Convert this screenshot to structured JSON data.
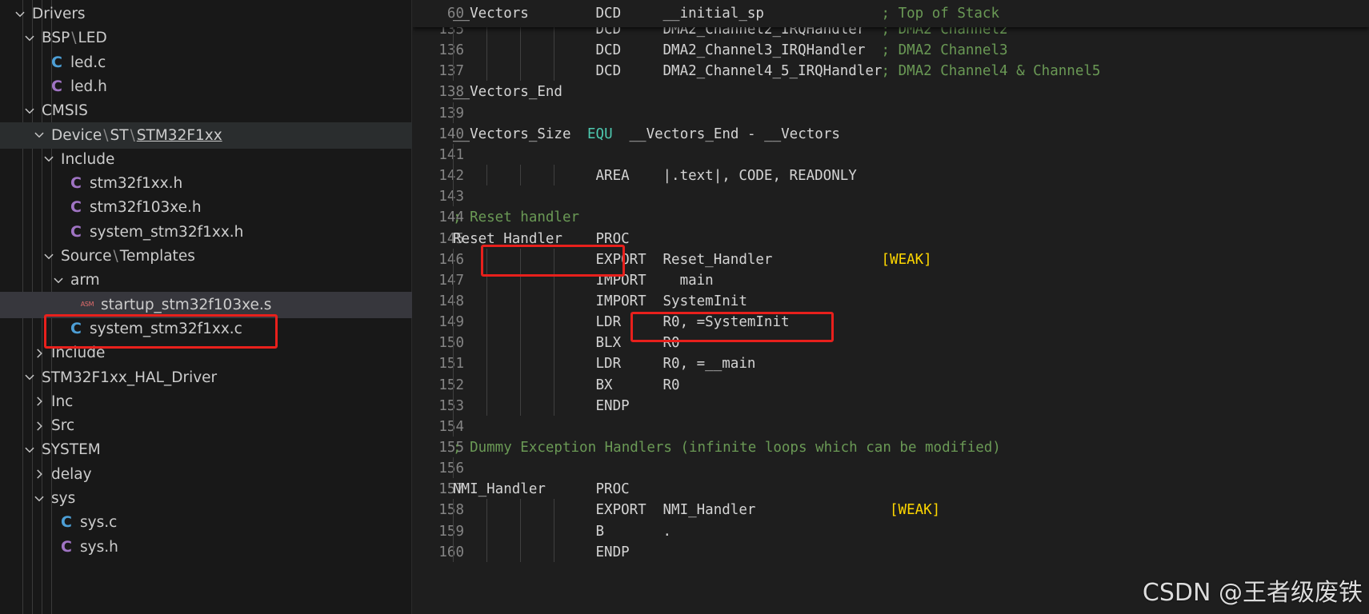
{
  "explorer": {
    "rows": [
      {
        "level": 0,
        "type": "folder",
        "expanded": true,
        "segments": [
          "Drivers"
        ]
      },
      {
        "level": 1,
        "type": "folder",
        "expanded": true,
        "segments": [
          "BSP",
          "LED"
        ]
      },
      {
        "level": 2,
        "type": "file",
        "icon": "c-file-icon",
        "color": "#4d9fd6",
        "segments": [
          "led.c"
        ]
      },
      {
        "level": 2,
        "type": "file",
        "icon": "c-header-icon",
        "color": "#a074c4",
        "segments": [
          "led.h"
        ]
      },
      {
        "level": 1,
        "type": "folder",
        "expanded": true,
        "segments": [
          "CMSIS"
        ]
      },
      {
        "level": 2,
        "type": "folder",
        "expanded": true,
        "segments": [
          "Device",
          "ST",
          "STM32F1xx"
        ],
        "underline_last": true,
        "state": "hover"
      },
      {
        "level": 3,
        "type": "folder",
        "expanded": true,
        "segments": [
          "Include"
        ]
      },
      {
        "level": 4,
        "type": "file",
        "icon": "c-header-icon",
        "color": "#a074c4",
        "segments": [
          "stm32f1xx.h"
        ]
      },
      {
        "level": 4,
        "type": "file",
        "icon": "c-header-icon",
        "color": "#a074c4",
        "segments": [
          "stm32f103xe.h"
        ]
      },
      {
        "level": 4,
        "type": "file",
        "icon": "c-header-icon",
        "color": "#a074c4",
        "segments": [
          "system_stm32f1xx.h"
        ]
      },
      {
        "level": 3,
        "type": "folder",
        "expanded": true,
        "segments": [
          "Source",
          "Templates"
        ]
      },
      {
        "level": 4,
        "type": "folder",
        "expanded": true,
        "segments": [
          "arm"
        ]
      },
      {
        "level": 5,
        "type": "file",
        "icon": "asm-file-icon",
        "icon_text": "ASM",
        "segments": [
          "startup_stm32f103xe.s"
        ],
        "state": "active"
      },
      {
        "level": 4,
        "type": "file",
        "icon": "c-file-icon",
        "color": "#4d9fd6",
        "segments": [
          "system_stm32f1xx.c"
        ]
      },
      {
        "level": 2,
        "type": "folder",
        "expanded": false,
        "segments": [
          "Include"
        ]
      },
      {
        "level": 1,
        "type": "folder",
        "expanded": true,
        "segments": [
          "STM32F1xx_HAL_Driver"
        ]
      },
      {
        "level": 2,
        "type": "folder",
        "expanded": false,
        "segments": [
          "Inc"
        ]
      },
      {
        "level": 2,
        "type": "folder",
        "expanded": false,
        "segments": [
          "Src"
        ]
      },
      {
        "level": 1,
        "type": "folder",
        "expanded": true,
        "segments": [
          "SYSTEM"
        ]
      },
      {
        "level": 2,
        "type": "folder",
        "expanded": false,
        "segments": [
          "delay"
        ]
      },
      {
        "level": 2,
        "type": "folder",
        "expanded": true,
        "segments": [
          "sys"
        ]
      },
      {
        "level": 3,
        "type": "file",
        "icon": "c-file-icon",
        "color": "#4d9fd6",
        "segments": [
          "sys.c"
        ]
      },
      {
        "level": 3,
        "type": "file",
        "icon": "c-header-icon",
        "color": "#a074c4",
        "segments": [
          "sys.h"
        ]
      }
    ]
  },
  "editor": {
    "sticky_line": {
      "num": "60",
      "tokens": [
        {
          "col": 0,
          "text": "__Vectors"
        },
        {
          "col": 17,
          "text": "DCD"
        },
        {
          "col": 25,
          "text": "__initial_sp"
        },
        {
          "col": 51,
          "text": "; Top of Stack",
          "cls": "cm"
        }
      ]
    },
    "lines": [
      {
        "num": "135",
        "partial": true,
        "guides": 4,
        "tokens": [
          {
            "col": 17,
            "text": "DCD"
          },
          {
            "col": 25,
            "text": "DMA2_Channel2_IRQHandler"
          },
          {
            "col": 51,
            "text": "; DMA2 Channel2",
            "cls": "cm"
          }
        ]
      },
      {
        "num": "136",
        "guides": 4,
        "tokens": [
          {
            "col": 17,
            "text": "DCD"
          },
          {
            "col": 25,
            "text": "DMA2_Channel3_IRQHandler"
          },
          {
            "col": 51,
            "text": "; DMA2 Channel3",
            "cls": "cm"
          }
        ]
      },
      {
        "num": "137",
        "guides": 4,
        "tokens": [
          {
            "col": 17,
            "text": "DCD"
          },
          {
            "col": 25,
            "text": "DMA2_Channel4_5_IRQHandler"
          },
          {
            "col": 51,
            "text": "; DMA2 Channel4 & Channel5",
            "cls": "cm"
          }
        ]
      },
      {
        "num": "138",
        "guides": 0,
        "tokens": [
          {
            "col": 0,
            "text": "__Vectors_End"
          }
        ]
      },
      {
        "num": "139",
        "guides": 1,
        "tokens": []
      },
      {
        "num": "140",
        "guides": 0,
        "tokens": [
          {
            "col": 0,
            "text": "__Vectors_Size"
          },
          {
            "col": 16,
            "text": "EQU",
            "cls": "kw"
          },
          {
            "col": 21,
            "text": "__Vectors_End - __Vectors"
          }
        ]
      },
      {
        "num": "141",
        "guides": 1,
        "tokens": []
      },
      {
        "num": "142",
        "guides": 4,
        "tokens": [
          {
            "col": 17,
            "text": "AREA"
          },
          {
            "col": 25,
            "text": "|.text|, CODE, READONLY"
          }
        ]
      },
      {
        "num": "143",
        "guides": 1,
        "tokens": []
      },
      {
        "num": "144",
        "guides": 0,
        "tokens": [
          {
            "col": 0,
            "text": "; Reset handler",
            "cls": "cm"
          }
        ]
      },
      {
        "num": "145",
        "guides": 0,
        "tokens": [
          {
            "col": 0,
            "text": "Reset_Handler"
          },
          {
            "col": 17,
            "text": "PROC"
          }
        ]
      },
      {
        "num": "146",
        "guides": 4,
        "tokens": [
          {
            "col": 17,
            "text": "EXPORT"
          },
          {
            "col": 25,
            "text": "Reset_Handler"
          },
          {
            "col": 51,
            "text": "[WEAK]",
            "cls": "br"
          }
        ]
      },
      {
        "num": "147",
        "guides": 4,
        "tokens": [
          {
            "col": 17,
            "text": "IMPORT"
          },
          {
            "col": 25,
            "text": "  main"
          }
        ]
      },
      {
        "num": "148",
        "guides": 4,
        "tokens": [
          {
            "col": 17,
            "text": "IMPORT"
          },
          {
            "col": 25,
            "text": "SystemInit"
          }
        ]
      },
      {
        "num": "149",
        "guides": 4,
        "tokens": [
          {
            "col": 17,
            "text": "LDR"
          },
          {
            "col": 25,
            "text": "R0, =SystemInit"
          }
        ]
      },
      {
        "num": "150",
        "guides": 4,
        "tokens": [
          {
            "col": 17,
            "text": "BLX"
          },
          {
            "col": 25,
            "text": "R0"
          }
        ]
      },
      {
        "num": "151",
        "guides": 4,
        "tokens": [
          {
            "col": 17,
            "text": "LDR"
          },
          {
            "col": 25,
            "text": "R0, =__main"
          }
        ]
      },
      {
        "num": "152",
        "guides": 4,
        "tokens": [
          {
            "col": 17,
            "text": "BX"
          },
          {
            "col": 25,
            "text": "R0"
          }
        ]
      },
      {
        "num": "153",
        "guides": 4,
        "tokens": [
          {
            "col": 17,
            "text": "ENDP"
          }
        ]
      },
      {
        "num": "154",
        "guides": 1,
        "tokens": []
      },
      {
        "num": "155",
        "guides": 0,
        "tokens": [
          {
            "col": 0,
            "text": "; Dummy Exception Handlers (infinite loops which can be modified)",
            "cls": "cm"
          }
        ]
      },
      {
        "num": "156",
        "guides": 1,
        "tokens": []
      },
      {
        "num": "157",
        "guides": 0,
        "tokens": [
          {
            "col": 0,
            "text": "NMI_Handler"
          },
          {
            "col": 17,
            "text": "PROC"
          }
        ]
      },
      {
        "num": "158",
        "guides": 4,
        "tokens": [
          {
            "col": 17,
            "text": "EXPORT"
          },
          {
            "col": 25,
            "text": "NMI_Handler"
          },
          {
            "col": 52,
            "text": "[WEAK]",
            "cls": "br"
          }
        ]
      },
      {
        "num": "159",
        "guides": 4,
        "tokens": [
          {
            "col": 17,
            "text": "B"
          },
          {
            "col": 25,
            "text": "."
          }
        ]
      },
      {
        "num": "160",
        "guides": 4,
        "tokens": [
          {
            "col": 17,
            "text": "ENDP"
          }
        ]
      }
    ]
  },
  "highlights": [
    "startup_stm32f103xe.s",
    "Reset_Handler",
    "IMPORT  SystemInit"
  ],
  "watermark": "CSDN @王者级废铁",
  "colors": {
    "highlight_box": "#e8201c",
    "comment": "#6a9955",
    "keyword": "#4ec9b0",
    "bracket": "#ffd700"
  }
}
